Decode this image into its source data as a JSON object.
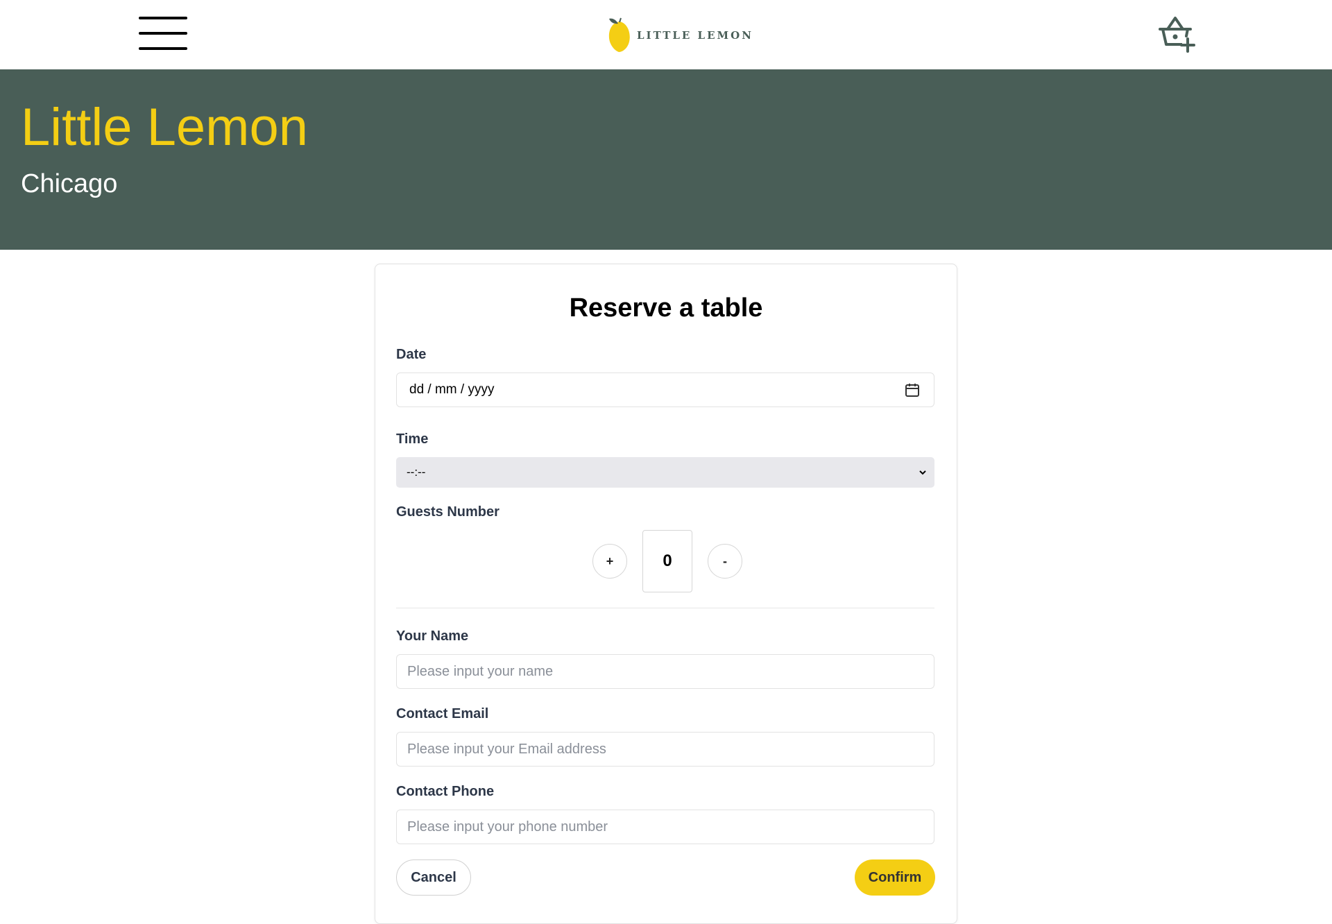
{
  "nav": {
    "logo_text": "LITTLE LEMON"
  },
  "hero": {
    "title": "Little Lemon",
    "subtitle": "Chicago"
  },
  "form": {
    "title": "Reserve a table",
    "date": {
      "label": "Date",
      "value": "dd / mm / yyyy"
    },
    "time": {
      "label": "Time",
      "selected": "--:--"
    },
    "guests": {
      "label": "Guests Number",
      "increment": "+",
      "decrement": "-",
      "value": "0"
    },
    "name": {
      "label": "Your Name",
      "placeholder": "Please input your name"
    },
    "email": {
      "label": "Contact Email",
      "placeholder": "Please input your Email address"
    },
    "phone": {
      "label": "Contact Phone",
      "placeholder": "Please input your phone number"
    },
    "cancel_label": "Cancel",
    "confirm_label": "Confirm"
  },
  "colors": {
    "primary_green": "#495e57",
    "primary_yellow": "#f4ce14",
    "input_border": "#e2e2e2",
    "select_bg": "#e8e8ec"
  },
  "icons": {
    "menu": "hamburger-menu-icon",
    "logo": "lemon-logo-icon",
    "cart": "basket-add-icon",
    "calendar": "calendar-icon",
    "dropdown": "chevron-down-icon"
  }
}
